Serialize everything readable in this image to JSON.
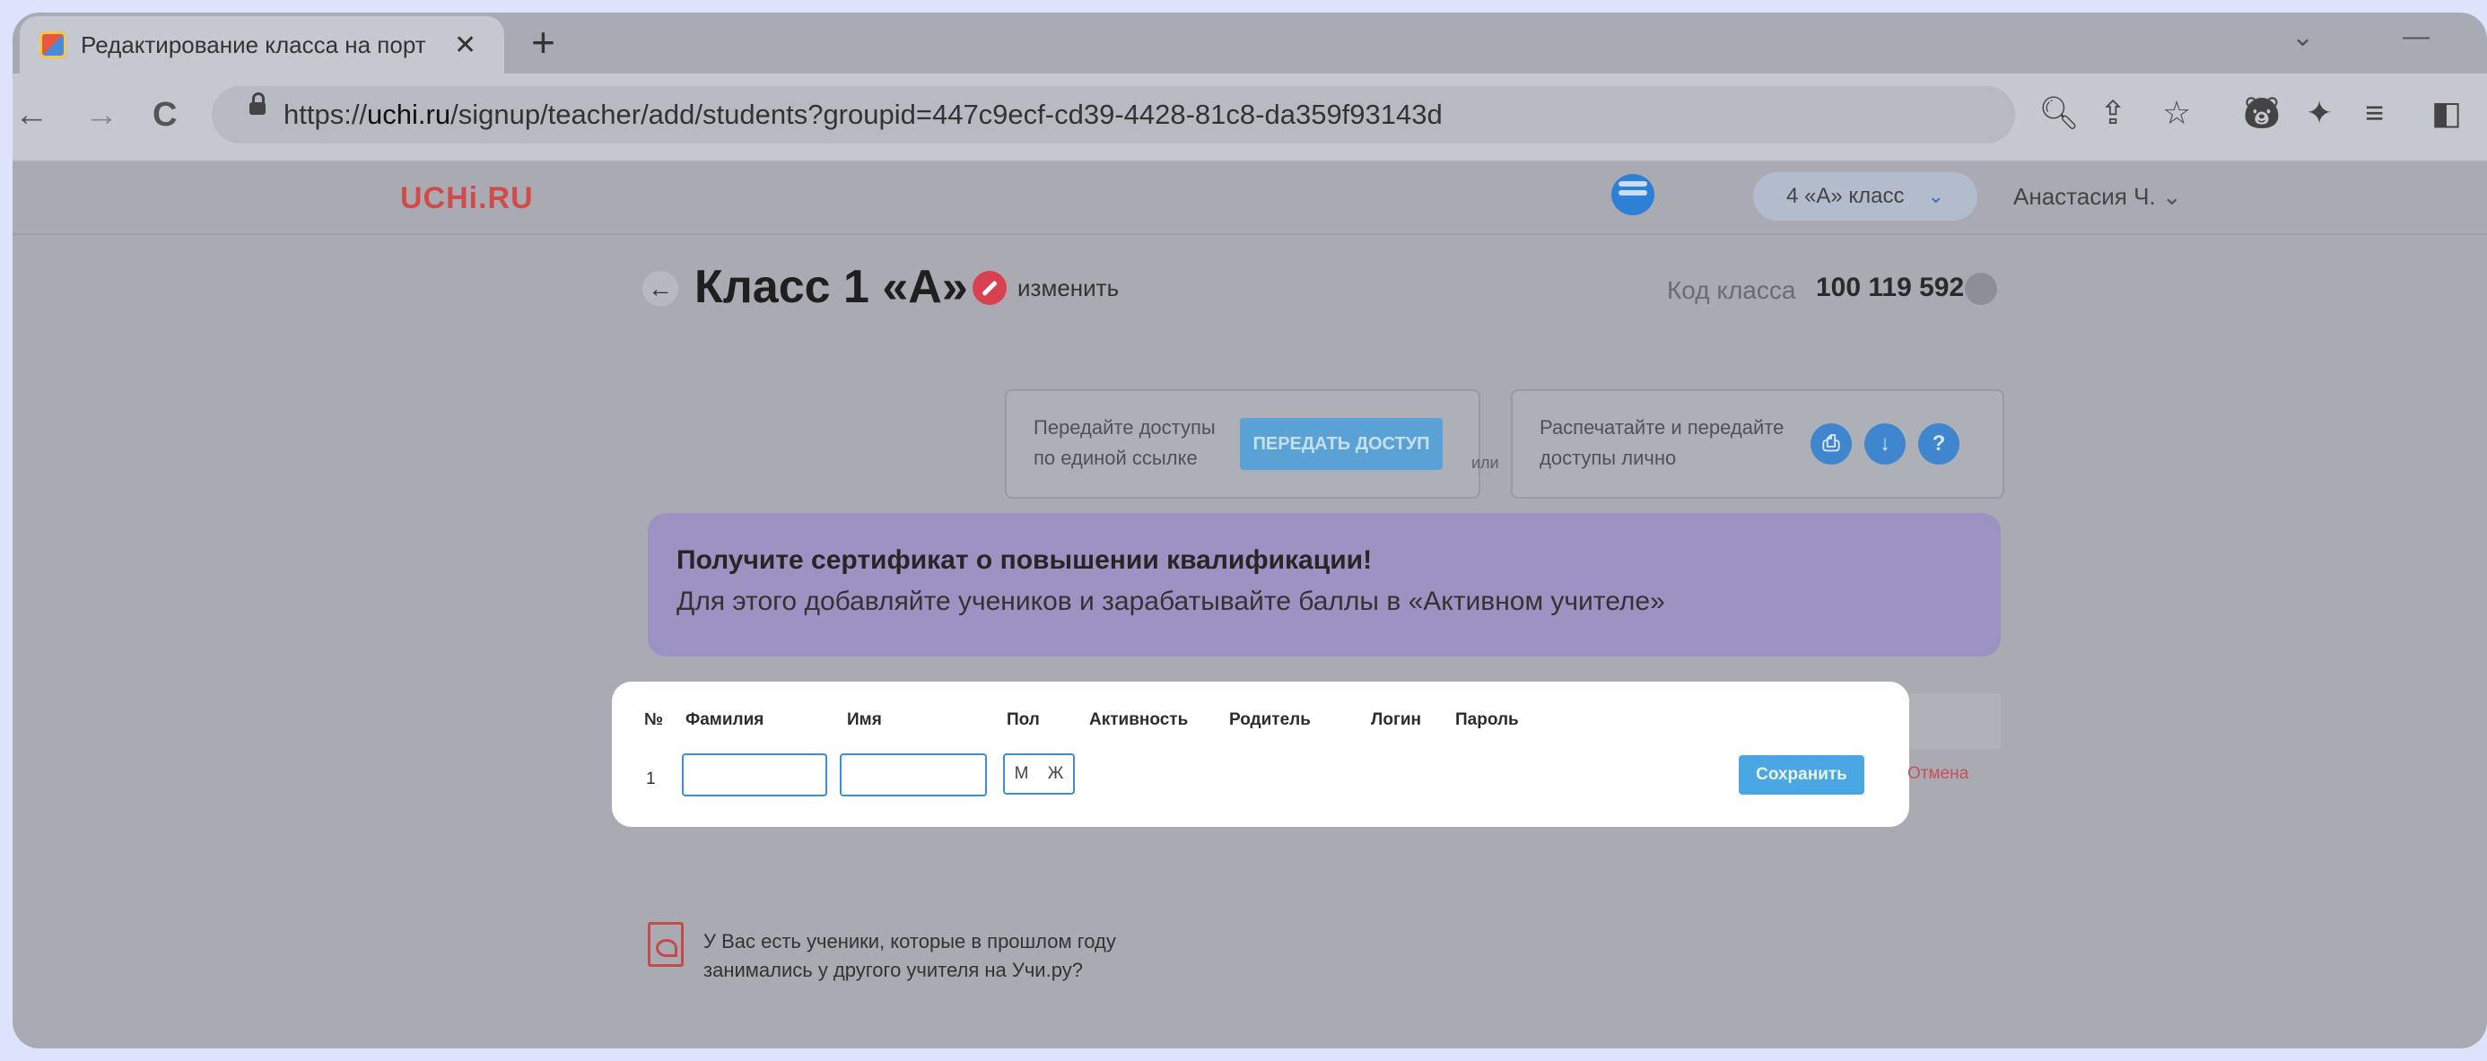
{
  "browser": {
    "tab_title": "Редактирование класса на порт",
    "tab_close": "✕",
    "new_tab": "+",
    "url_prefix": "https://",
    "url_host": "uchi.ru",
    "url_path": "/signup/teacher/add/students?groupid=447c9ecf-cd39-4428-81c8-da359f93143d",
    "back": "←",
    "forward": "→",
    "reload": "C",
    "win_minimize_chevron": "⌄",
    "win_minimize": "—"
  },
  "header": {
    "logo": "UCHi.RU",
    "class_select": "4 «А» класс",
    "user_name": "Анастасия Ч."
  },
  "class": {
    "back": "←",
    "title": "Класс 1 «А»",
    "edit_label": "изменить",
    "code_label": "Код класса",
    "code_value": "100 119 592"
  },
  "access": {
    "link_text_1": "Передайте доступы",
    "link_text_2": "по единой ссылке",
    "link_button": "ПЕРЕДАТЬ ДОСТУП",
    "or_label": "или",
    "print_text_1": "Распечатайте и передайте",
    "print_text_2": "доступы лично",
    "help_label": "?"
  },
  "banner": {
    "title": "Получите сертификат о повышении квалификации!",
    "subtitle": "Для этого добавляйте учеников и зарабатывайте баллы в «Активном учителе»"
  },
  "table": {
    "headers": [
      "№",
      "Фамилия",
      "Имя",
      "Пол",
      "Активность",
      "Родитель",
      "Логин",
      "Пароль"
    ],
    "row_number": "1",
    "gender_m": "М",
    "gender_f": "Ж",
    "save_label": "Сохранить",
    "cancel_label": "Отмена"
  },
  "footer": {
    "migrate_line_1": "У Вас есть ученики, которые в прошлом году",
    "migrate_line_2": "занимались у другого учителя на Учи.ру?"
  }
}
